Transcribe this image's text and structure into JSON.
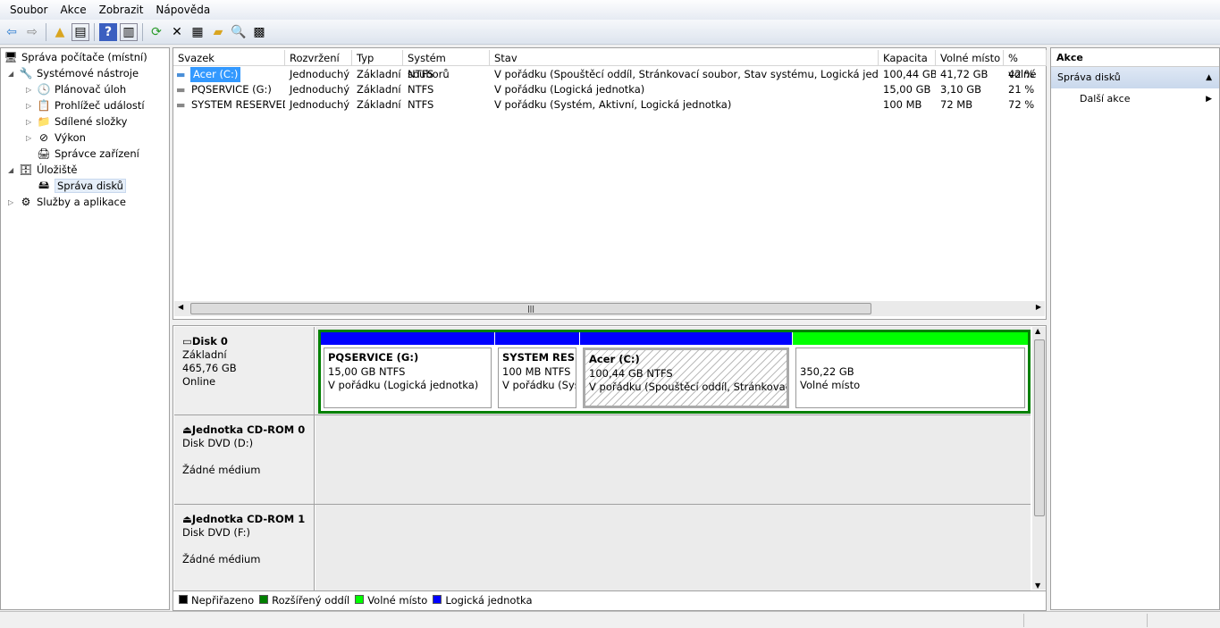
{
  "menu": [
    "Soubor",
    "Akce",
    "Zobrazit",
    "Nápověda"
  ],
  "tree": {
    "root": "Správa počítače (místní)",
    "system_tools": "Systémové nástroje",
    "task_scheduler": "Plánovač úloh",
    "event_viewer": "Prohlížeč událostí",
    "shared_folders": "Sdílené složky",
    "performance": "Výkon",
    "device_manager": "Správce zařízení",
    "storage": "Úložiště",
    "disk_management": "Správa disků",
    "services": "Služby a aplikace"
  },
  "volumes": {
    "columns": [
      "Svazek",
      "Rozvržení",
      "Typ",
      "Systém souborů",
      "Stav",
      "Kapacita",
      "Volné místo",
      "% volné"
    ],
    "rows": [
      [
        "Acer (C:)",
        "Jednoduchý",
        "Základní",
        "NTFS",
        "V pořádku (Spouštěcí oddíl, Stránkovací soubor, Stav systému, Logická jednotka)",
        "100,44 GB",
        "41,72 GB",
        "42 %"
      ],
      [
        "PQSERVICE (G:)",
        "Jednoduchý",
        "Základní",
        "NTFS",
        "V pořádku (Logická jednotka)",
        "15,00 GB",
        "3,10 GB",
        "21 %"
      ],
      [
        "SYSTEM RESERVED",
        "Jednoduchý",
        "Základní",
        "NTFS",
        "V pořádku (Systém, Aktivní, Logická jednotka)",
        "100 MB",
        "72 MB",
        "72 %"
      ]
    ]
  },
  "disks": [
    {
      "name": "Disk 0",
      "type": "Základní",
      "size": "465,76 GB",
      "status": "Online",
      "partitions": [
        {
          "title": "PQSERVICE  (G:)",
          "size": "15,00 GB NTFS",
          "status": "V pořádku (Logická jednotka)"
        },
        {
          "title": "SYSTEM RESERVED",
          "size": "100 MB NTFS",
          "status": "V pořádku (Systém, Aktivní, Logická jednotka)"
        },
        {
          "title": "Acer  (C:)",
          "size": "100,44 GB NTFS",
          "status": "V pořádku (Spouštěcí oddíl, Stránkovací soubor, Stav systému, Logická jednotka)"
        },
        {
          "title": "",
          "size": "350,22 GB",
          "status": "Volné místo"
        }
      ]
    },
    {
      "name": "Jednotka CD-ROM 0",
      "type": "Disk DVD (D:)",
      "status": "Žádné médium"
    },
    {
      "name": "Jednotka CD-ROM 1",
      "type": "Disk DVD (F:)",
      "status": "Žádné médium"
    }
  ],
  "legend": [
    {
      "label": "Nepřiřazeno",
      "color": "#000000"
    },
    {
      "label": "Rozšířený oddíl",
      "color": "#008000"
    },
    {
      "label": "Volné místo",
      "color": "#00ff00"
    },
    {
      "label": "Logická jednotka",
      "color": "#0000ff"
    }
  ],
  "actions": {
    "title": "Akce",
    "section": "Správa disků",
    "more": "Další akce"
  }
}
